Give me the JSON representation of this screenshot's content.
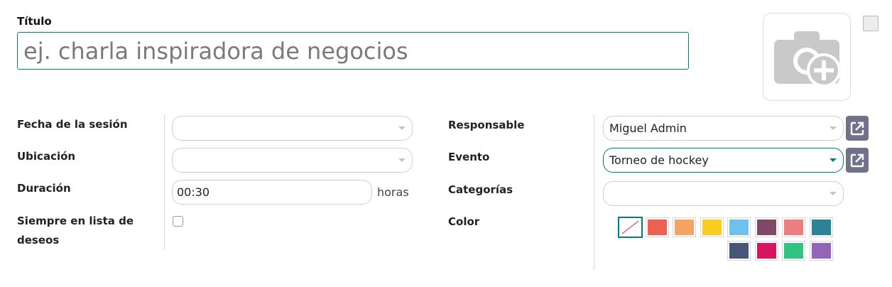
{
  "title": {
    "label": "Título",
    "placeholder": "ej. charla inspiradora de negocios",
    "value": ""
  },
  "image": {
    "icon": "camera-add-icon"
  },
  "left_fields": {
    "session_date": {
      "label": "Fecha de la sesión",
      "value": ""
    },
    "location": {
      "label": "Ubicación",
      "value": ""
    },
    "duration": {
      "label": "Duración",
      "value": "00:30",
      "unit": "horas"
    },
    "always_wishlist": {
      "label_line1": "Siempre en lista de",
      "label_line2": "deseos",
      "checked": false
    }
  },
  "right_fields": {
    "responsible": {
      "label": "Responsable",
      "value": "Miguel Admin"
    },
    "event": {
      "label": "Evento",
      "value": "Torneo de hockey"
    },
    "categories": {
      "label": "Categorías",
      "value": ""
    },
    "color": {
      "label": "Color"
    }
  },
  "colors": [
    "#ffffff",
    "#f06050",
    "#f4a460",
    "#f7cd1f",
    "#6cc1ed",
    "#814968",
    "#eb7e7f",
    "#2c8397",
    "#475577",
    "#d6145f",
    "#30c381",
    "#9365b8"
  ],
  "accent": "#017e84",
  "icons": {
    "external_link": "external-link-icon",
    "dropdown": "caret-down-icon"
  }
}
